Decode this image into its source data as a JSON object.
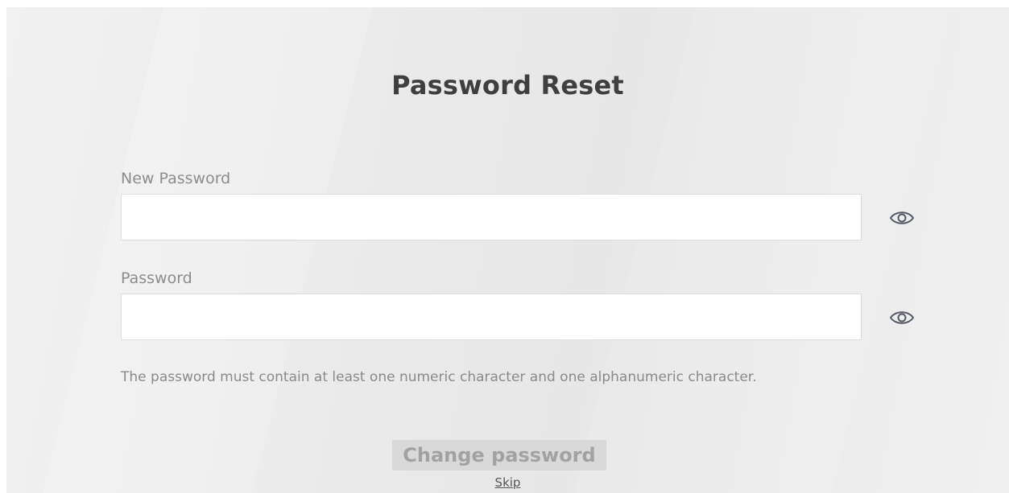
{
  "page": {
    "title": "Password Reset"
  },
  "form": {
    "new_password": {
      "label": "New Password",
      "value": "",
      "placeholder": "",
      "toggle_icon": "eye-icon"
    },
    "password": {
      "label": "Password",
      "value": "",
      "placeholder": "",
      "toggle_icon": "eye-icon"
    },
    "hint": "The password must contain at least one numeric character and one alphanumeric character.",
    "submit_label": "Change password",
    "skip_label": "Skip"
  },
  "colors": {
    "title": "#3f3f3f",
    "label": "#8c8c8c",
    "icon": "#555a66",
    "button_bg": "#d9d9d9",
    "button_text": "#a2a2a2"
  }
}
